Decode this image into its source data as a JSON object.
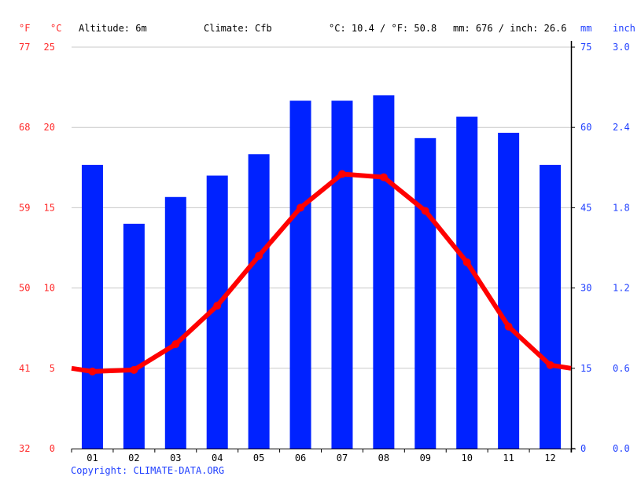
{
  "header": {
    "unit_f": "°F",
    "unit_c": "°C",
    "altitude": "Altitude: 6m",
    "climate": "Climate: Cfb",
    "avg_temp": "°C: 10.4 / °F: 50.8",
    "avg_precip": "mm: 676 / inch: 26.6",
    "unit_mm": "mm",
    "unit_inch": "inch"
  },
  "footer": {
    "copyright": "Copyright: CLIMATE-DATA.ORG"
  },
  "colors": {
    "temperature": "#ff0000",
    "precipitation": "#0022ff",
    "grid": "#c8c8c8",
    "axis_red_text": "#ff2a2a",
    "axis_blue_text": "#1f3fff"
  },
  "chart_data": {
    "type": "bar",
    "title": "",
    "categories": [
      "01",
      "02",
      "03",
      "04",
      "05",
      "06",
      "07",
      "08",
      "09",
      "10",
      "11",
      "12"
    ],
    "series": [
      {
        "name": "Precipitation (mm)",
        "type": "bar",
        "axis": "right",
        "values": [
          53,
          42,
          47,
          51,
          55,
          65,
          65,
          66,
          58,
          62,
          59,
          53
        ]
      },
      {
        "name": "Temperature (°C)",
        "type": "line",
        "axis": "left",
        "values": [
          4.8,
          4.9,
          6.5,
          8.9,
          12.0,
          15.0,
          17.1,
          16.9,
          14.8,
          11.6,
          7.6,
          5.2
        ],
        "edge_start": 5.0,
        "edge_end": 5.0
      }
    ],
    "axes": {
      "left_c": {
        "label": "°C",
        "range": [
          0,
          25
        ],
        "ticks": [
          "0",
          "5",
          "10",
          "15",
          "20",
          "25"
        ]
      },
      "left_f": {
        "label": "°F",
        "ticks": [
          "32",
          "41",
          "50",
          "59",
          "68",
          "77"
        ]
      },
      "right_mm": {
        "label": "mm",
        "range": [
          0,
          75
        ],
        "ticks": [
          "0",
          "15",
          "30",
          "45",
          "60",
          "75"
        ]
      },
      "right_inch": {
        "label": "inch",
        "ticks": [
          "0.0",
          "0.6",
          "1.2",
          "1.8",
          "2.4",
          "3.0"
        ]
      }
    },
    "grid": true,
    "legend": "none"
  }
}
